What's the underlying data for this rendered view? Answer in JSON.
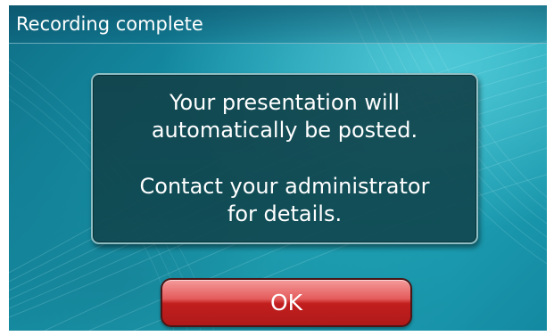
{
  "header": {
    "title": "Recording complete"
  },
  "dialog": {
    "lines": [
      "Your presentation will",
      "automatically be posted.",
      "Contact your administrator",
      "for details."
    ]
  },
  "actions": {
    "ok_label": "OK"
  },
  "colors": {
    "background_accent": "#1591a8",
    "dialog_fill": "#12424a",
    "button_red": "#c21e1e"
  }
}
